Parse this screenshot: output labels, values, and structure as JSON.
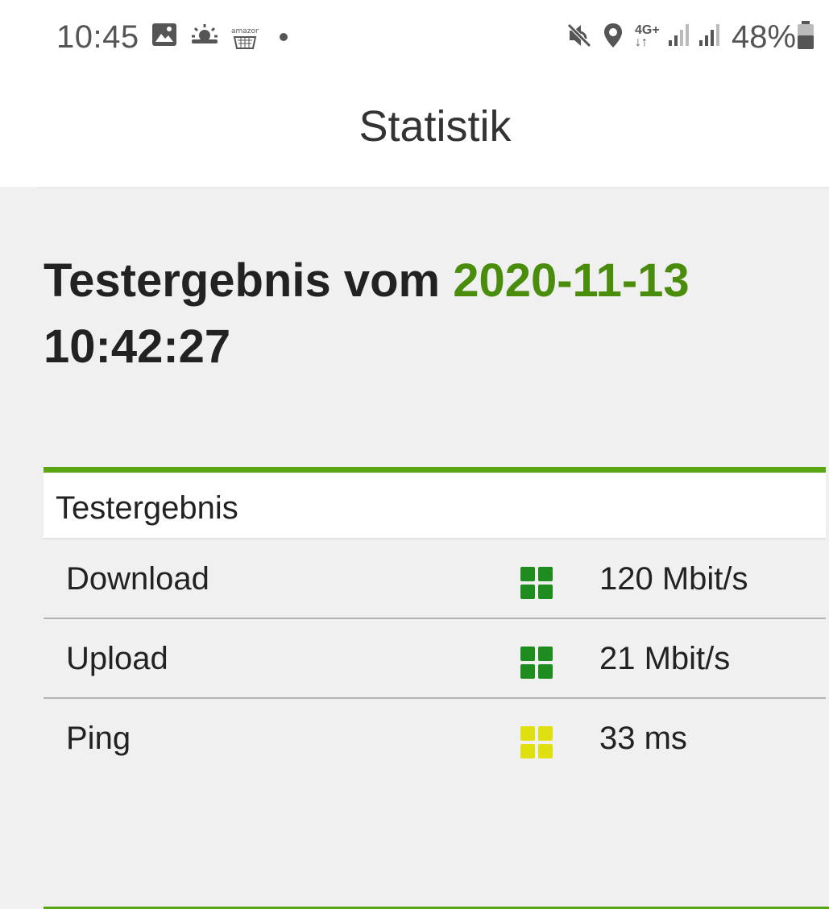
{
  "status_bar": {
    "time": "10:45",
    "battery": "48%",
    "network": "4G+",
    "notification_icons": [
      "image-icon",
      "weather-icon",
      "amazon-icon",
      "dot-icon"
    ],
    "system_icons": [
      "mute-icon",
      "location-icon",
      "signal-icon",
      "battery-icon"
    ]
  },
  "app_bar": {
    "title": "Statistik"
  },
  "heading": {
    "prefix": "Testergebnis vom ",
    "date": "2020-11-13",
    "time": "10:42:27"
  },
  "results": {
    "header": "Testergebnis",
    "rows": [
      {
        "label": "Download",
        "value": "120 Mbit/s",
        "quality_color": "#1e8c1e"
      },
      {
        "label": "Upload",
        "value": "21 Mbit/s",
        "quality_color": "#1e8c1e"
      },
      {
        "label": "Ping",
        "value": "33 ms",
        "quality_color": "#e0e010"
      }
    ]
  },
  "colors": {
    "accent": "#5aa514",
    "date": "#4a8c0c"
  }
}
